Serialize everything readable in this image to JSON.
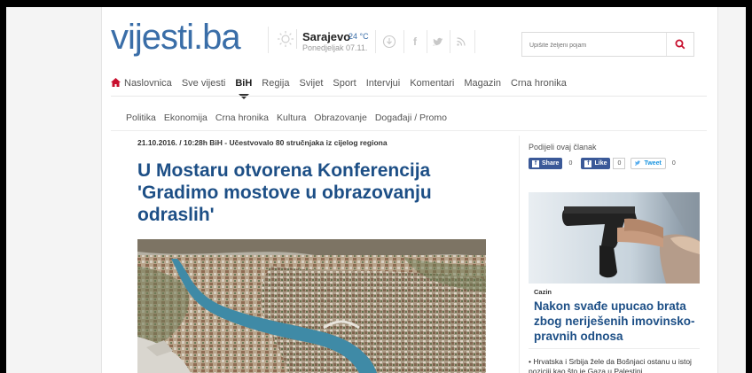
{
  "header": {
    "logo_main": "vijesti",
    "logo_dot": ".",
    "logo_tld": "ba",
    "weather_city": "Sarajevo",
    "weather_temp": "24 °C",
    "weather_day": "Ponedjeljak 07.11.",
    "search_placeholder": "Upišite željeni pojam",
    "icons": [
      "sun-icon",
      "download-icon",
      "facebook-icon",
      "twitter-icon",
      "rss-icon",
      "search-icon"
    ]
  },
  "nav": {
    "items": [
      "Naslovnica",
      "Sve vijesti",
      "BiH",
      "Regija",
      "Svijet",
      "Sport",
      "Intervjui",
      "Komentari",
      "Magazin",
      "Crna hronika"
    ],
    "active": "BiH"
  },
  "subnav": {
    "items": [
      "Politika",
      "Ekonomija",
      "Crna hronika",
      "Kultura",
      "Obrazovanje",
      "Događaji / Promo"
    ]
  },
  "article": {
    "meta": "21.10.2016. / 10:28h BiH - Učestvovalo 80 stručnjaka iz cijelog regiona",
    "title": "U Mostaru otvorena Konferencija 'Gradimo mostove u obrazovanju odraslih'"
  },
  "sidebar": {
    "share_label": "Podijeli ovaj članak",
    "share_buttons": [
      {
        "label": "Share",
        "count": "0"
      },
      {
        "label": "Like",
        "count": "0"
      },
      {
        "label": "Tweet",
        "count": "0"
      }
    ],
    "story_category": "Cazin",
    "story_title": "Nakon svađe upucao brata zbog neriješenih imovinsko-pravnih odnosa",
    "bullet_text": "Hrvatska i Srbija žele da Bošnjaci ostanu u istoj poziciji kao što je Gaza u Palestini"
  },
  "colors": {
    "brand": "#3a6ea8",
    "title_blue": "#1d4f86",
    "accent_red": "#c8102e",
    "facebook": "#3b5998",
    "twitter": "#55acee"
  }
}
